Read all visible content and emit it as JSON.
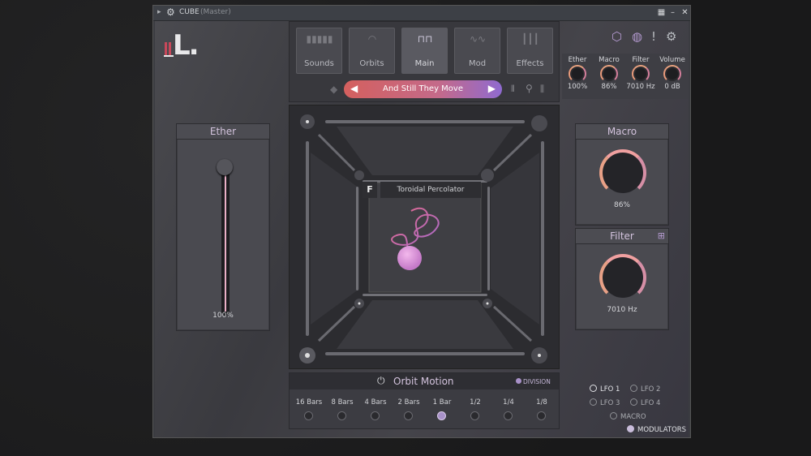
{
  "window": {
    "title": "CUBE",
    "subtitle": "(Master)"
  },
  "tabs": [
    {
      "label": "Sounds",
      "active": false
    },
    {
      "label": "Orbits",
      "active": false
    },
    {
      "label": "Main",
      "active": true
    },
    {
      "label": "Mod",
      "active": false
    },
    {
      "label": "Effects",
      "active": false
    }
  ],
  "preset": {
    "name": "And Still They Move"
  },
  "top_knobs": [
    {
      "label": "Ether",
      "value": "100%"
    },
    {
      "label": "Macro",
      "value": "86%"
    },
    {
      "label": "Filter",
      "value": "7010 Hz"
    },
    {
      "label": "Volume",
      "value": "0 dB"
    }
  ],
  "ether_panel": {
    "title": "Ether",
    "value": "100%",
    "level": 1.0
  },
  "macro_panel": {
    "title": "Macro",
    "value": "86%",
    "level": 0.86
  },
  "filter_panel": {
    "title": "Filter",
    "value": "7010 Hz"
  },
  "cube": {
    "badge": "F",
    "sound_name": "Toroidal Percolator"
  },
  "orbit_motion": {
    "title": "Orbit Motion",
    "division_label": "DIVISION",
    "bars": [
      "16 Bars",
      "8 Bars",
      "4 Bars",
      "2 Bars",
      "1 Bar",
      "1/2",
      "1/4",
      "1/8"
    ],
    "selected_index": 4
  },
  "modulators": {
    "lfo1": "LFO 1",
    "lfo2": "LFO 2",
    "lfo3": "LFO 3",
    "lfo4": "LFO 4",
    "macro": "MACRO",
    "label": "MODULATORS"
  },
  "colors": {
    "accent_pink": "#e9b0c6",
    "accent_purple": "#a891c8",
    "preset_start": "#d4605e",
    "preset_end": "#8f6ad0"
  }
}
